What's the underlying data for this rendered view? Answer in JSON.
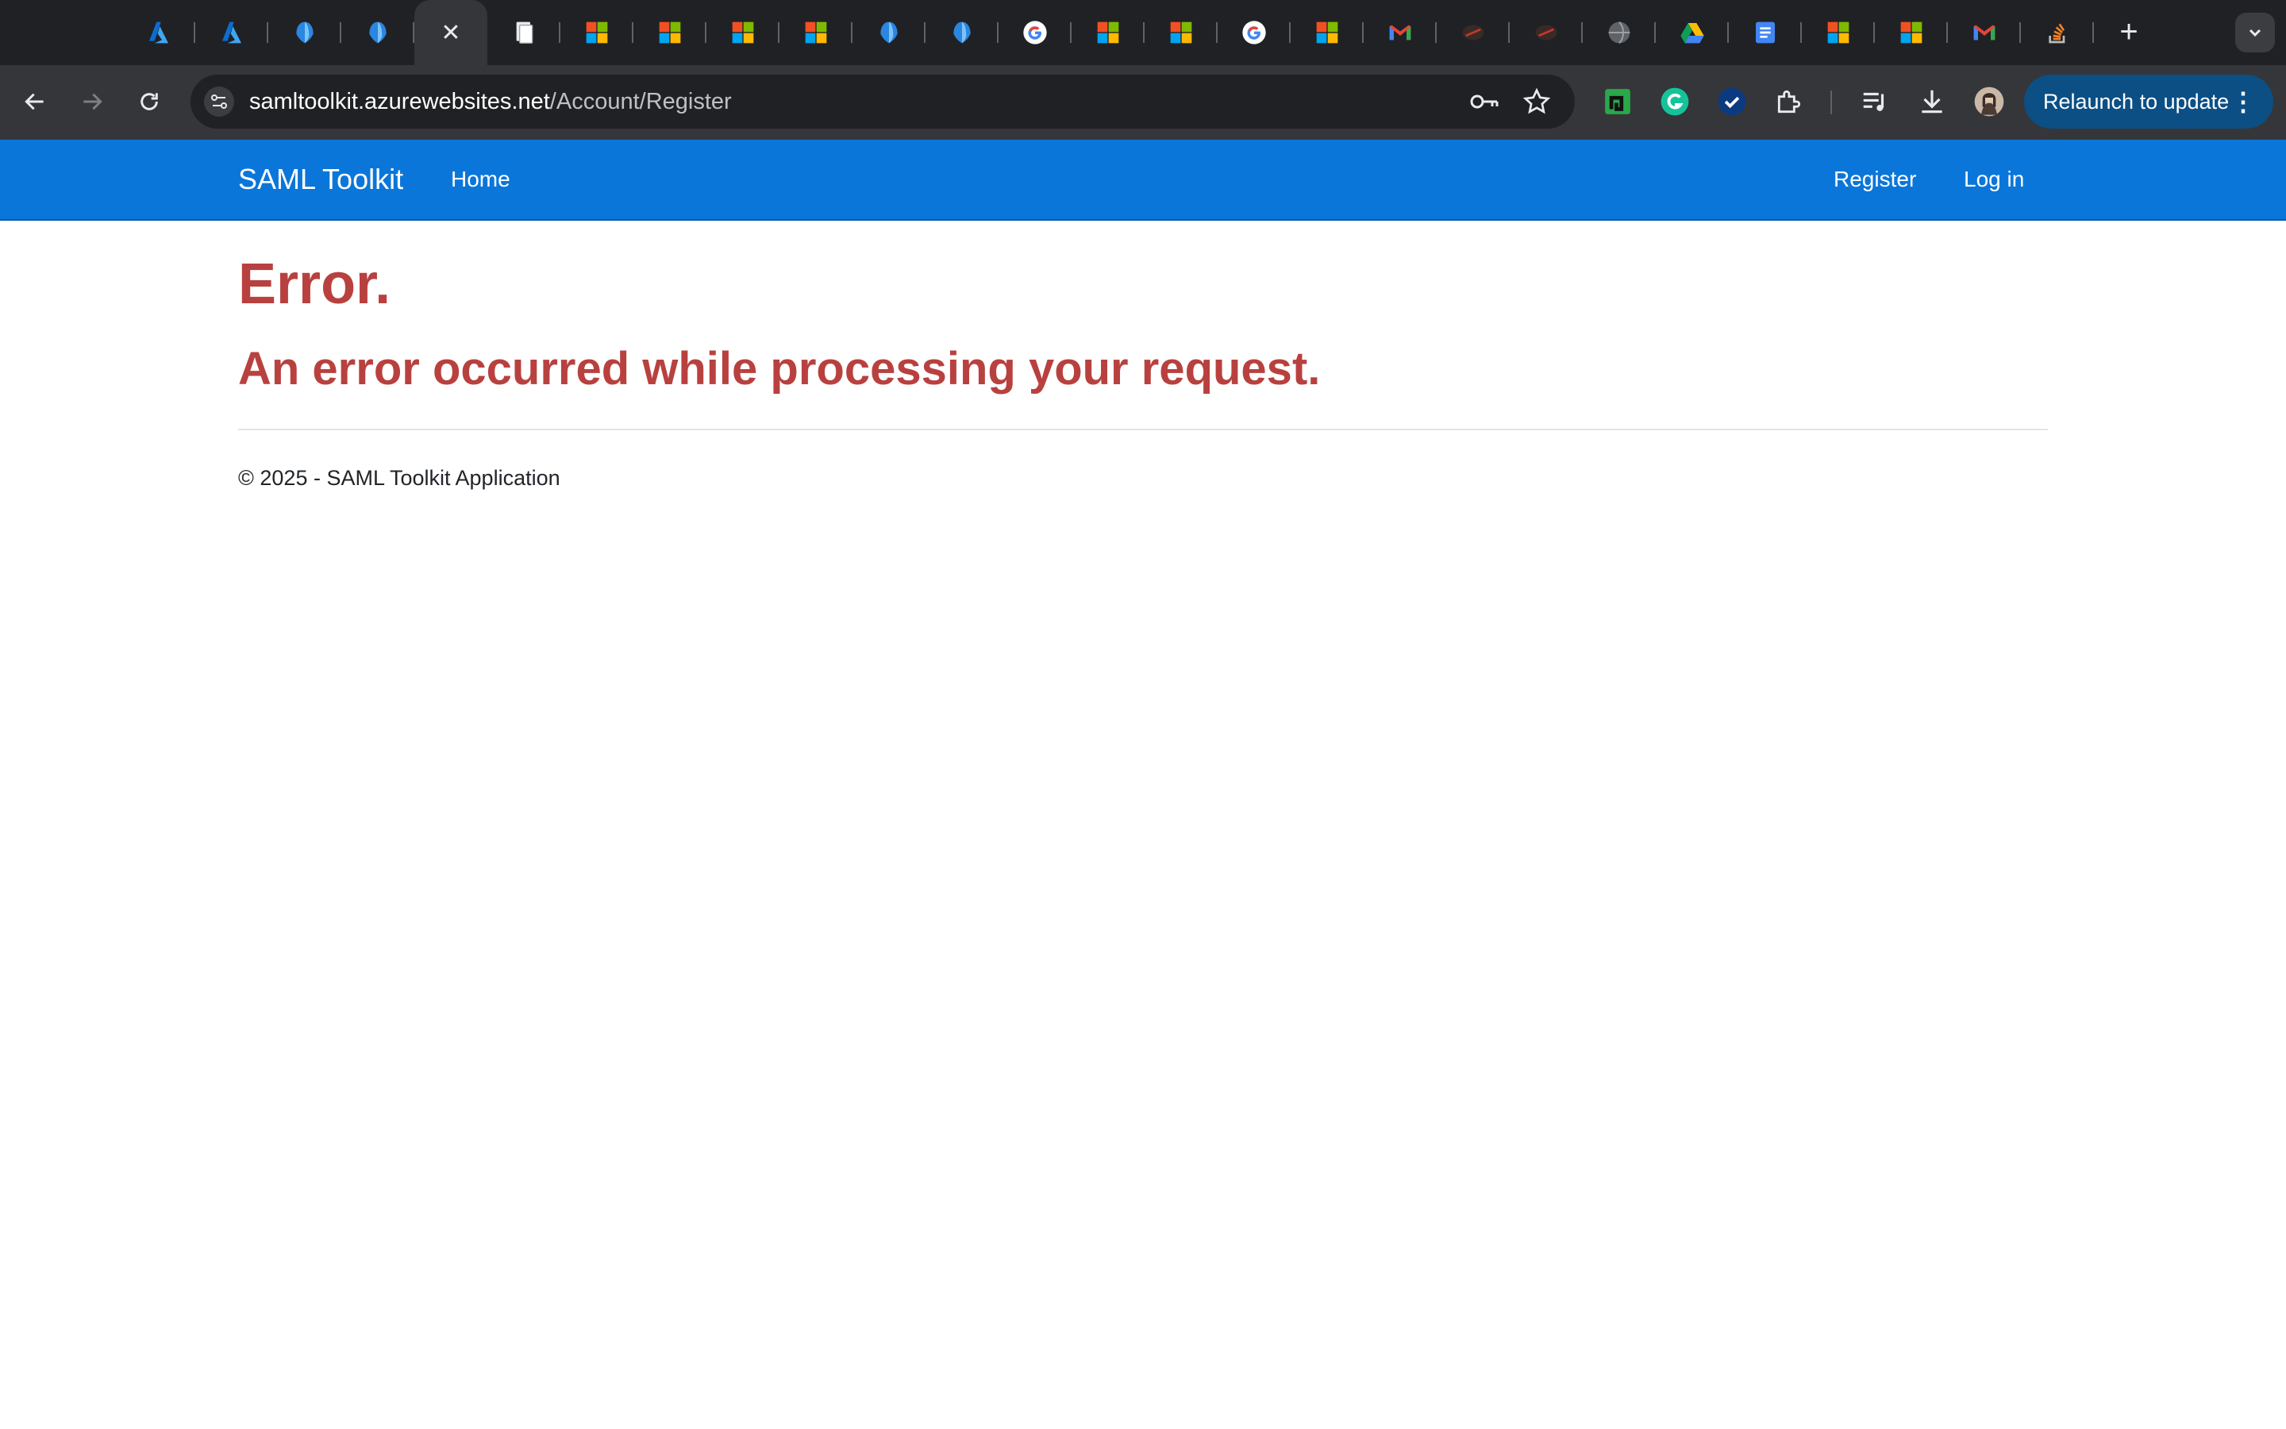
{
  "browser": {
    "tabs": [
      {
        "icon": "azure-icon"
      },
      {
        "icon": "azure-icon"
      },
      {
        "icon": "entra-icon"
      },
      {
        "icon": "entra-icon"
      },
      {
        "icon": "close-icon",
        "active": true
      },
      {
        "icon": "document-icon"
      },
      {
        "icon": "microsoft-icon"
      },
      {
        "icon": "microsoft-icon"
      },
      {
        "icon": "microsoft-icon"
      },
      {
        "icon": "microsoft-icon"
      },
      {
        "icon": "entra-icon"
      },
      {
        "icon": "entra-icon"
      },
      {
        "icon": "google-icon"
      },
      {
        "icon": "microsoft-icon"
      },
      {
        "icon": "microsoft-icon"
      },
      {
        "icon": "google-icon"
      },
      {
        "icon": "microsoft-icon"
      },
      {
        "icon": "gmail-icon"
      },
      {
        "icon": "dark-app-icon"
      },
      {
        "icon": "dark-app-icon"
      },
      {
        "icon": "globe-icon"
      },
      {
        "icon": "google-drive-icon"
      },
      {
        "icon": "google-docs-icon"
      },
      {
        "icon": "microsoft-icon"
      },
      {
        "icon": "microsoft-icon"
      },
      {
        "icon": "gmail-icon"
      },
      {
        "icon": "stack-overflow-icon"
      }
    ],
    "close_glyph": "✕",
    "new_tab_glyph": "+",
    "address": {
      "host": "samltoolkit.azurewebsites.net",
      "path": "/Account/Register"
    },
    "relaunch_label": "Relaunch to update",
    "menu_glyph": "⋮"
  },
  "site": {
    "brand": "SAML Toolkit",
    "nav_home": "Home",
    "nav_register": "Register",
    "nav_login": "Log in",
    "nav_color": "#0b76d9"
  },
  "error": {
    "title": "Error.",
    "message": "An error occurred while processing your request.",
    "color": "#b8413f"
  },
  "footer": {
    "text": "© 2025 - SAML Toolkit Application"
  }
}
